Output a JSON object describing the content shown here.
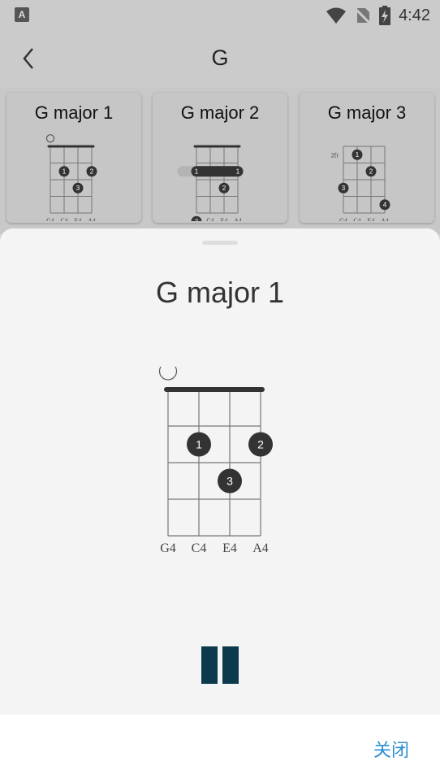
{
  "status_bar": {
    "time": "4:42",
    "left_icon_letter": "A"
  },
  "app_bar": {
    "title": "G"
  },
  "cards": [
    {
      "title": "G major 1"
    },
    {
      "title": "G major 2"
    },
    {
      "title": "G major 3"
    }
  ],
  "card_chords": [
    {
      "open_marker": true,
      "fret_label": "",
      "dots": [
        {
          "string": 2,
          "fret": 2,
          "finger": "1"
        },
        {
          "string": 4,
          "fret": 2,
          "finger": "2"
        },
        {
          "string": 3,
          "fret": 3,
          "finger": "3"
        }
      ],
      "barre": null
    },
    {
      "open_marker": false,
      "fret_label": "",
      "dots": [
        {
          "string": 3,
          "fret": 3,
          "finger": "2"
        },
        {
          "string": 1,
          "fret": 5,
          "finger": "3"
        }
      ],
      "barre": {
        "fret": 2,
        "from_string": 1,
        "to_string": 4,
        "left_finger": "1",
        "right_finger": "1"
      }
    },
    {
      "open_marker": false,
      "fret_label": "2fr",
      "dots": [
        {
          "string": 2,
          "fret": 1,
          "finger": "1"
        },
        {
          "string": 3,
          "fret": 2,
          "finger": "2"
        },
        {
          "string": 1,
          "fret": 3,
          "finger": "3"
        },
        {
          "string": 4,
          "fret": 4,
          "finger": "4"
        }
      ],
      "barre": null
    }
  ],
  "string_names": [
    "G4",
    "C4",
    "E4",
    "A4"
  ],
  "sheet": {
    "title": "G major 1",
    "chord": {
      "open_marker": true,
      "dots": [
        {
          "string": 2,
          "fret": 2,
          "finger": "1"
        },
        {
          "string": 4,
          "fret": 2,
          "finger": "2"
        },
        {
          "string": 3,
          "fret": 3,
          "finger": "3"
        }
      ]
    }
  },
  "footer": {
    "close_label": "关闭"
  },
  "colors": {
    "accent": "#2c8ed0",
    "pause": "#0c3a4c",
    "dot": "#333333"
  }
}
